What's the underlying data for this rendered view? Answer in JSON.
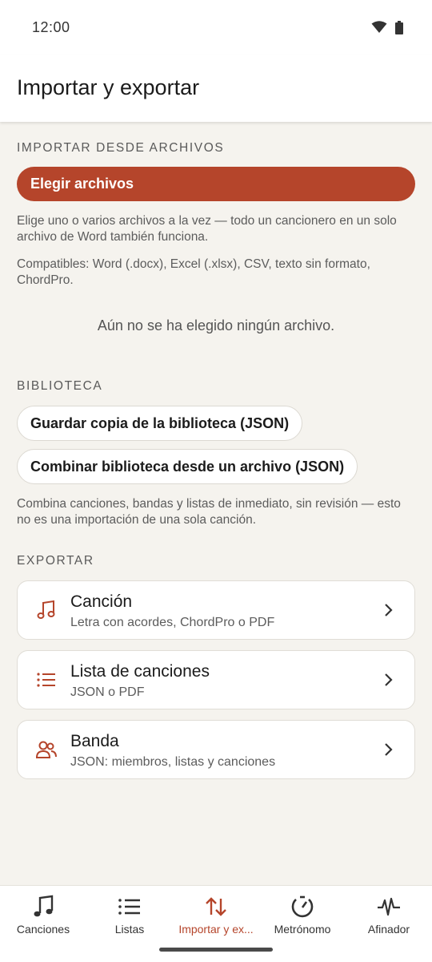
{
  "status_bar": {
    "time": "12:00",
    "icons": [
      "wifi-icon",
      "battery-icon"
    ]
  },
  "app_bar": {
    "title": "Importar y exportar"
  },
  "import_section": {
    "header": "IMPORTAR DESDE ARCHIVOS",
    "choose_button": "Elegir archivos",
    "help_1": "Elige uno o varios archivos a la vez — todo un cancionero en un solo archivo de Word también funciona.",
    "help_2": "Compatibles: Word (.docx), Excel (.xlsx), CSV, texto sin formato, ChordPro.",
    "empty_state": "Aún no se ha elegido ningún archivo."
  },
  "library_section": {
    "header": "BIBLIOTECA",
    "save_button": "Guardar copia de la biblioteca (JSON)",
    "merge_button": "Combinar biblioteca desde un archivo (JSON)",
    "help": "Combina canciones, bandas y listas de inmediato, sin revisión — esto no es una importación de una sola canción."
  },
  "export_section": {
    "header": "EXPORTAR",
    "items": [
      {
        "title": "Canción",
        "subtitle": "Letra con acordes, ChordPro o PDF",
        "icon": "music-note-icon"
      },
      {
        "title": "Lista de canciones",
        "subtitle": "JSON o PDF",
        "icon": "list-icon"
      },
      {
        "title": "Banda",
        "subtitle": "JSON: miembros, listas y canciones",
        "icon": "people-icon"
      }
    ]
  },
  "bottom_nav": {
    "items": [
      {
        "label": "Canciones",
        "icon": "music-note-icon"
      },
      {
        "label": "Listas",
        "icon": "list-icon"
      },
      {
        "label": "Importar y ex...",
        "icon": "import-export-icon",
        "active": true
      },
      {
        "label": "Metrónomo",
        "icon": "metronome-icon"
      },
      {
        "label": "Afinador",
        "icon": "tuner-icon"
      }
    ]
  },
  "colors": {
    "accent": "#b5452b",
    "background": "#f5f3ee",
    "surface": "#ffffff"
  }
}
